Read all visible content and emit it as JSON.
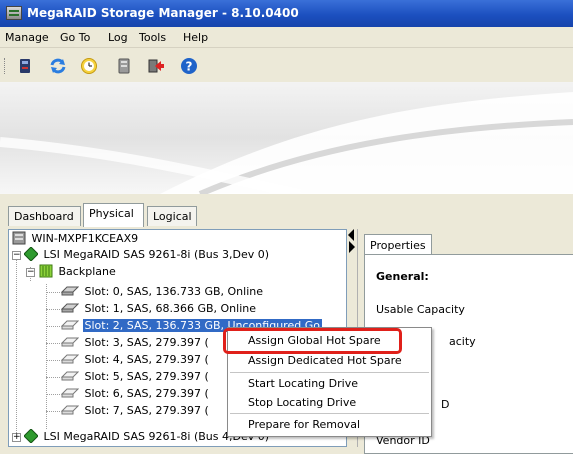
{
  "window": {
    "title": "MegaRAID Storage Manager - 8.10.0400"
  },
  "menu": [
    "Manage",
    "Go To",
    "Log",
    "Tools",
    "Help"
  ],
  "toolbar_icons": [
    "scan-icon",
    "refresh-icon",
    "clock-icon",
    "disk-icon",
    "exit-icon",
    "help-icon"
  ],
  "view_tabs": [
    "Dashboard",
    "Physical",
    "Logical"
  ],
  "active_view_tab": "Physical",
  "tree": {
    "host": "WIN-MXPF1KCEAX9",
    "controller": "LSI MegaRAID SAS 9261-8i (Bus 3,Dev 0)",
    "backplane": "Backplane",
    "slots": [
      "Slot: 0, SAS, 136.733 GB, Online",
      "Slot: 1, SAS, 68.366 GB, Online",
      "Slot: 2, SAS, 136.733 GB, Unconfigured Go",
      "Slot: 3, SAS, 279.397 (",
      "Slot: 4, SAS, 279.397 (",
      "Slot: 5, SAS, 279.397 (",
      "Slot: 6, SAS, 279.397 (",
      "Slot: 7, SAS, 279.397 ("
    ],
    "selected_slot_index": 2,
    "controller2": "LSI MegaRAID SAS 9261-8i (Bus 4,Dev 0)"
  },
  "properties": {
    "tab": "Properties",
    "heading": "General:",
    "labels": [
      "Usable Capacity",
      "acity",
      "D",
      "Vendor ID"
    ]
  },
  "context_menu": {
    "items": [
      "Assign Global Hot Spare",
      "Assign Dedicated Hot Spare",
      "Start Locating Drive",
      "Stop Locating Drive",
      "Prepare for Removal"
    ],
    "highlighted": "Assign Global Hot Spare"
  },
  "colors": {
    "selection": "#316ac5",
    "highlight_box": "#e0201a",
    "titlebar": "#1c50c0"
  }
}
